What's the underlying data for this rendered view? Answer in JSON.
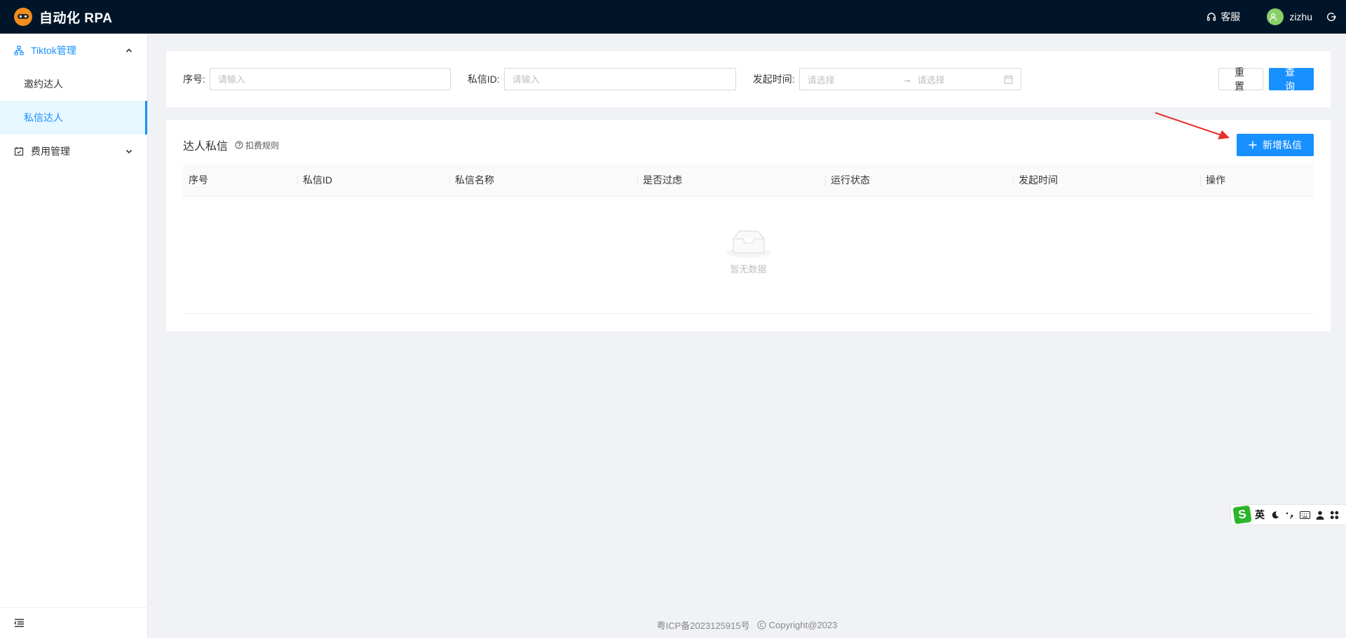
{
  "header": {
    "app_title": "自动化 RPA",
    "service_label": "客服",
    "username": "zizhu",
    "logo_icon": "rpa-robot-logo",
    "service_icon": "headset-icon",
    "logout_icon": "logout-icon"
  },
  "sidebar": {
    "groups": [
      {
        "label": "Tiktok管理",
        "icon": "cluster-icon",
        "expanded": true,
        "items": [
          {
            "label": "邀约达人"
          },
          {
            "label": "私信达人"
          }
        ]
      },
      {
        "label": "费用管理",
        "icon": "schedule-icon",
        "expanded": false
      }
    ],
    "selected_item": "私信达人",
    "collapse_icon": "menu-fold-icon"
  },
  "search": {
    "seq_label": "序号:",
    "seq_placeholder": "请输入",
    "dm_id_label": "私信ID:",
    "dm_id_placeholder": "请输入",
    "time_label": "发起时间:",
    "start_placeholder": "请选择",
    "end_placeholder": "请选择",
    "separator": "→",
    "reset_label": "重置",
    "query_label": "查询"
  },
  "list": {
    "title": "达人私信",
    "rule_link": "扣费规则",
    "add_button": "新增私信",
    "columns": [
      "序号",
      "私信ID",
      "私信名称",
      "是否过虑",
      "运行状态",
      "发起时间",
      "操作"
    ],
    "rows": [],
    "empty_text": "暂无数据"
  },
  "footer": {
    "icp": "粤ICP备2023125915号",
    "copyright": "Copyright@2023"
  },
  "ime": {
    "lang": "英"
  },
  "colors": {
    "header_bg": "#001529",
    "primary": "#1890ff",
    "page_bg": "#f0f2f5",
    "annotation_arrow": "#e8302a"
  }
}
